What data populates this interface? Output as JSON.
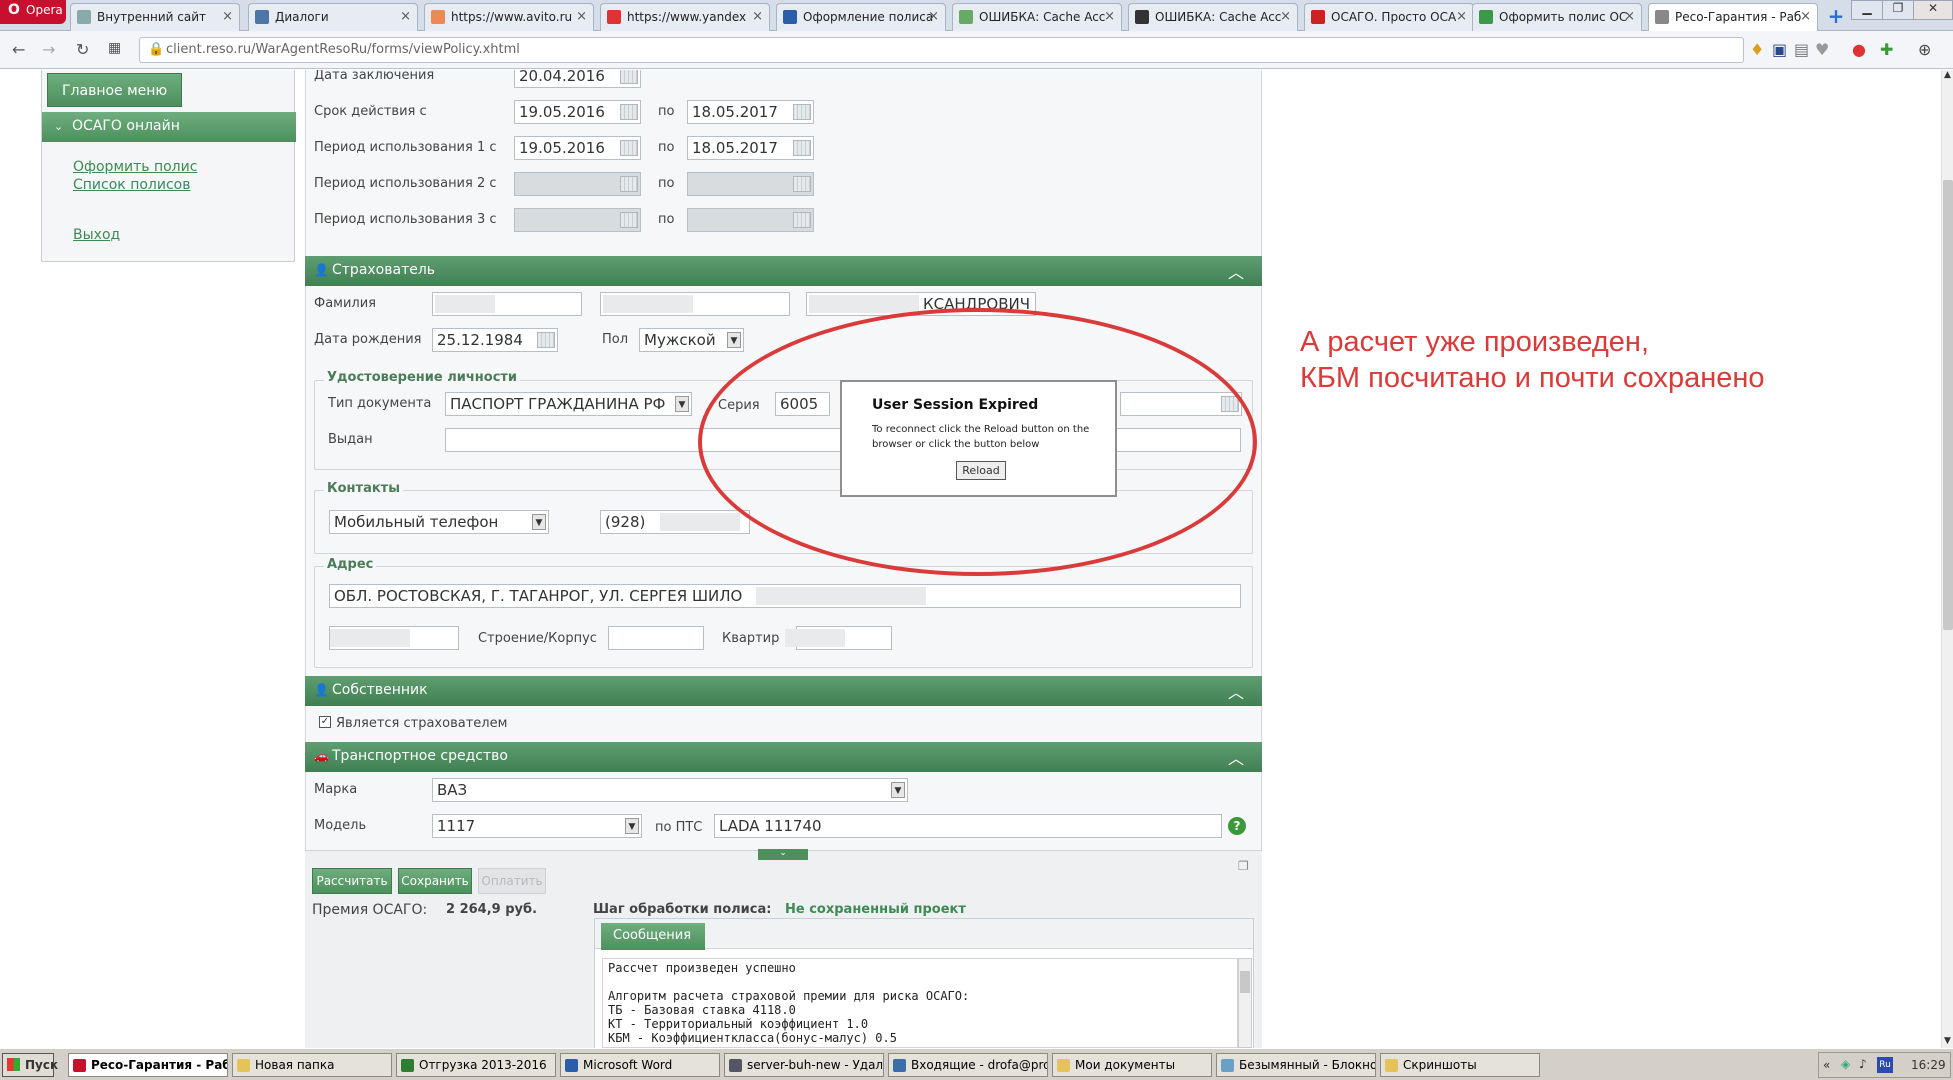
{
  "browser": {
    "opera_label": "Opera",
    "tabs": [
      {
        "label": "Внутренний сайт"
      },
      {
        "label": "Диалоги"
      },
      {
        "label": "https://www.avito.ru"
      },
      {
        "label": "https://www.yandex"
      },
      {
        "label": "Оформление полиса"
      },
      {
        "label": "ОШИБКА: Cache Acc"
      },
      {
        "label": "ОШИБКА: Cache Acc"
      },
      {
        "label": "ОСАГО. Просто ОСА"
      },
      {
        "label": "Оформить полис ОС"
      },
      {
        "label": "Ресо-Гарантия - Раб"
      }
    ],
    "new_tab": "+",
    "url": "client.reso.ru/WarAgentResoRu/forms/viewPolicy.xhtml"
  },
  "sidebar": {
    "main_menu": "Главное меню",
    "section": "ОСАГО онлайн",
    "links": [
      "Оформить полис",
      "Список полисов",
      "Выход"
    ]
  },
  "policy": {
    "date_concluded_label": "Дата заключения",
    "date_concluded": "20.04.2016",
    "term_label": "Срок действия с",
    "term_from": "19.05.2016",
    "to_label": "по",
    "term_to": "18.05.2017",
    "period1_label": "Период использования 1 с",
    "period1_from": "19.05.2016",
    "period1_to": "18.05.2017",
    "period2_label": "Период использования 2 с",
    "period3_label": "Период использования 3 с"
  },
  "insurer": {
    "section_title": "Страхователь",
    "surname_label": "Фамилия",
    "patronymic_visible": "КСАНДРОВИЧ",
    "dob_label": "Дата рождения",
    "dob": "25.12.1984",
    "gender_label": "Пол",
    "gender": "Мужской",
    "id_group_title": "Удостоверение личности",
    "doc_type_label": "Тип документа",
    "doc_type": "ПАСПОРТ ГРАЖДАНИНА РФ",
    "series_label": "Серия",
    "series": "6005",
    "issued_label": "Выдан",
    "contacts_title": "Контакты",
    "contact_type": "Мобильный телефон",
    "phone": "(928)",
    "address_title": "Адрес",
    "address": "ОБЛ. РОСТОВСКАЯ, Г. ТАГАНРОГ, УЛ. СЕРГЕЯ ШИЛО",
    "building_label": "Строение/Корпус",
    "apartment_label": "Квартир"
  },
  "owner": {
    "section_title": "Собственник",
    "is_insurer_label": "Является страхователем",
    "is_insurer": true
  },
  "vehicle": {
    "section_title": "Транспортное средство",
    "make_label": "Марка",
    "make": "ВАЗ",
    "model_label": "Модель",
    "model": "1117",
    "pts_label": "по ПТС",
    "pts_model": "LADA 111740",
    "help": "?"
  },
  "actions": {
    "calculate": "Рассчитать",
    "save": "Сохранить",
    "pay": "Оплатить",
    "premium_label": "Премия ОСАГО:",
    "premium": "2 264,9 руб.",
    "step_label": "Шаг обработки полиса:",
    "step_value": "Не сохраненный проект",
    "messages_tab": "Сообщения",
    "messages": [
      "Рассчет произведен успешно",
      "",
      "Алгоритм расчета страховой премии для риска ОСАГО:",
      "ТБ - Базовая ставка 4118.0",
      "КТ - Территориальный коэффициент 1.0",
      "КБМ - Коэффициентклacса(бонус-малус) 0.5"
    ]
  },
  "dialog": {
    "title": "User Session Expired",
    "message": "To reconnect click the Reload button on the browser or click the button below",
    "button": "Reload"
  },
  "annotation": {
    "line1": "А расчет уже произведен,",
    "line2": "КБМ посчитано и почти сохранено",
    "color": "#d93a3a"
  },
  "taskbar": {
    "start": "Пуск",
    "items": [
      "Ресо-Гарантия - Раб...",
      "Новая папка",
      "Отгрузка 2013-2016",
      "Microsoft Word",
      "server-buh-new - Удале...",
      "Входящие - drofa@prot...",
      "Мои документы",
      "Безымянный - Блокнот",
      "Скриншоты"
    ],
    "lang": "Ru",
    "clock": "16:29"
  }
}
